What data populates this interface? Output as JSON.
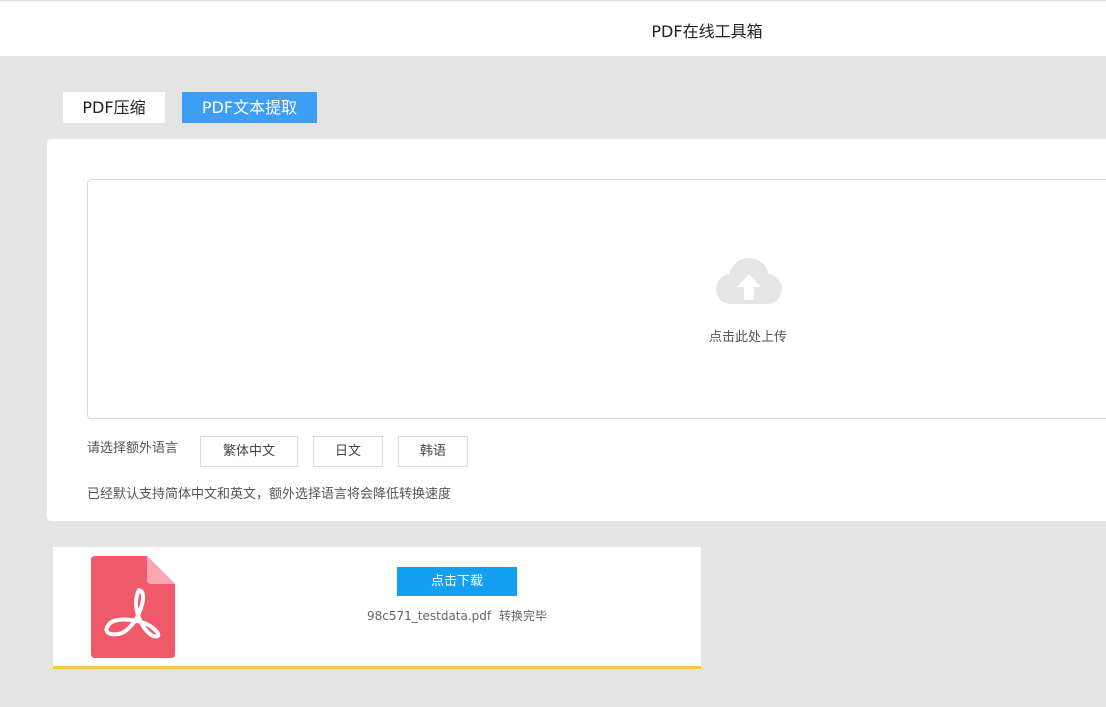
{
  "header": {
    "title": "PDF在线工具箱"
  },
  "tabs": [
    {
      "label": "PDF压缩",
      "active": false
    },
    {
      "label": "PDF文本提取",
      "active": true
    }
  ],
  "upload": {
    "icon": "cloud-upload-icon",
    "text": "点击此处上传"
  },
  "language": {
    "label": "请选择额外语言",
    "options": [
      "繁体中文",
      "日文",
      "韩语"
    ],
    "note": "已经默认支持简体中文和英文，额外选择语言将会降低转换速度"
  },
  "result": {
    "icon": "pdf-file-icon",
    "download_label": "点击下载",
    "filename": "98c571_testdata.pdf",
    "status": "转换完毕"
  },
  "colors": {
    "accent": "#3d9ef8",
    "download": "#14a0f0",
    "pdf_icon": "#f0596a",
    "progress_bar": "#f5c545",
    "background": "#e4e4e4"
  }
}
